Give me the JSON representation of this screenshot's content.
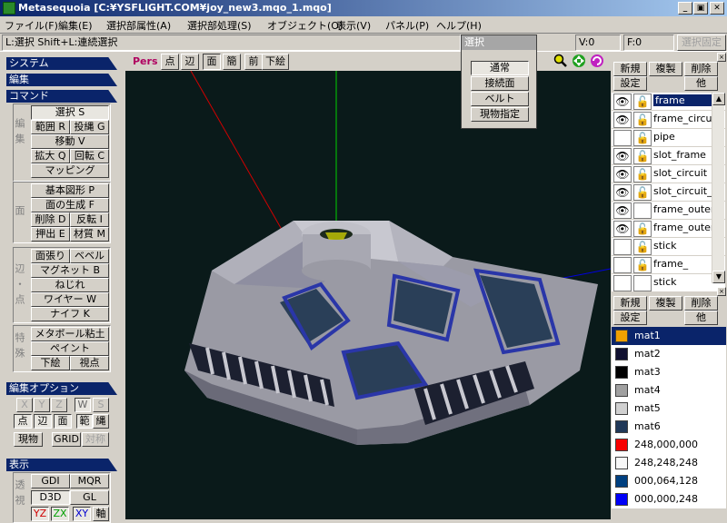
{
  "window": {
    "title": "Metasequoia [C:¥YSFLIGHT.COM¥joy_new3.mqo_1.mqo]",
    "min": "_",
    "max": "▣",
    "close": "✕"
  },
  "menu": [
    "ファイル(F)",
    "編集(E)",
    "選択部属性(A)",
    "選択部処理(S)",
    "オブジェクト(O)",
    "表示(V)",
    "パネル(P)",
    "ヘルプ(H)"
  ],
  "status": {
    "hint": "L:選択  Shift+L:連続選択",
    "v": "V:0",
    "f": "F:0",
    "fix": "選択固定"
  },
  "left": {
    "system": "システム",
    "edit": "編集",
    "command": "コマンド",
    "g1label": "編集",
    "g1": [
      "選択 S",
      "範囲 R",
      "投縄 G",
      "移動 V",
      "拡大 Q",
      "回転 C",
      "マッピング"
    ],
    "g2label": "面",
    "g2": [
      "基本図形 P",
      "面の生成 F",
      "削除 D",
      "反転 I",
      "押出 E",
      "材質 M"
    ],
    "g3label": "辺・点",
    "g3": [
      "面張り",
      "ベベル",
      "マグネット B",
      "ねじれ",
      "ワイヤー W",
      "ナイフ K"
    ],
    "g4label": "特殊",
    "g4": [
      "メタボール粘土",
      "ペイント",
      "下絵",
      "視点"
    ],
    "opt": "編集オプション",
    "opts": [
      "X",
      "Y",
      "Z",
      "W",
      "S",
      "点",
      "辺",
      "面",
      "範",
      "縄",
      "現物",
      "GRID",
      "対称"
    ],
    "disp": "表示",
    "displabel": "透視",
    "dispb": [
      "GDI",
      "MQR",
      "D3D",
      "GL",
      "YZ",
      "ZX",
      "XY",
      "軸"
    ]
  },
  "view": {
    "pers": "Pers",
    "tabs": [
      "点",
      "辺",
      "面",
      "簡",
      "前",
      "下絵"
    ]
  },
  "popup": {
    "title": "選択",
    "items": [
      "通常",
      "接続面",
      "ベルト",
      "現物指定"
    ]
  },
  "objpanel": {
    "new": "新規",
    "copy": "複製",
    "del": "削除",
    "set": "設定",
    "other": "他",
    "items": [
      {
        "name": "frame",
        "vis": "👁",
        "lock": "🔓",
        "sel": true
      },
      {
        "name": "frame_circuit",
        "vis": "👁",
        "lock": "🔓"
      },
      {
        "name": "pipe",
        "vis": "",
        "lock": "🔓"
      },
      {
        "name": "slot_frame",
        "vis": "👁",
        "lock": "🔓"
      },
      {
        "name": "slot_circuit",
        "vis": "👁",
        "lock": "🔓"
      },
      {
        "name": "slot_circuit_l",
        "vis": "👁",
        "lock": "🔓"
      },
      {
        "name": "frame_outer_",
        "vis": "👁",
        "lock": ""
      },
      {
        "name": "frame_outer",
        "vis": "👁",
        "lock": "🔓"
      },
      {
        "name": "stick",
        "vis": "",
        "lock": "🔓"
      },
      {
        "name": "frame_",
        "vis": "",
        "lock": "🔓"
      },
      {
        "name": "stick",
        "vis": "",
        "lock": ""
      }
    ]
  },
  "matpanel": {
    "new": "新規",
    "copy": "複製",
    "del": "削除",
    "set": "設定",
    "other": "他",
    "items": [
      {
        "name": "mat1",
        "color": "#f0a000",
        "sel": true
      },
      {
        "name": "mat2",
        "color": "#101030"
      },
      {
        "name": "mat3",
        "color": "#000000"
      },
      {
        "name": "mat4",
        "color": "#a0a0a0"
      },
      {
        "name": "mat5",
        "color": "#d0d0d0"
      },
      {
        "name": "mat6",
        "color": "#203858"
      },
      {
        "name": "248,000,000",
        "color": "#f80000"
      },
      {
        "name": "248,248,248",
        "color": "#f8f8f8"
      },
      {
        "name": "000,064,128",
        "color": "#004080"
      },
      {
        "name": "000,000,248",
        "color": "#0000f8"
      }
    ]
  }
}
